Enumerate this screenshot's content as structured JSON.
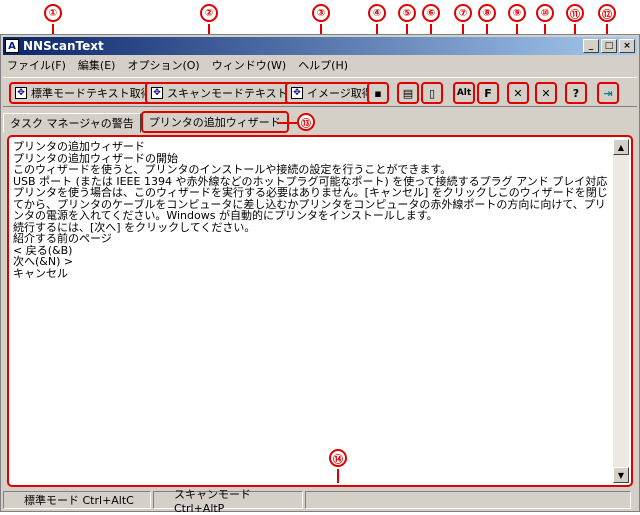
{
  "callouts": [
    "①",
    "②",
    "③",
    "④",
    "⑤",
    "⑥",
    "⑦",
    "⑧",
    "⑨",
    "⑩",
    "⑪",
    "⑫",
    "⑬",
    "⑭"
  ],
  "window": {
    "title": "NNScanText",
    "min_label": "_",
    "max_label": "□",
    "close_label": "×"
  },
  "menu": [
    "ファイル(F)",
    "編集(E)",
    "オプション(O)",
    "ウィンドウ(W)",
    "ヘルプ(H)"
  ],
  "toolbar": {
    "standard_label": "標準モードテキスト取得",
    "scan_label": "スキャンモードテキスト取得",
    "image_label": "イメージ取得",
    "alt_label": "Alt",
    "f_label": "F",
    "help_label": "?"
  },
  "tabs": [
    "タスク マネージャの警告",
    "プリンタの追加ウィザード"
  ],
  "content": {
    "text": "プリンタの追加ウィザード\nプリンタの追加ウィザードの開始\nこのウィザードを使うと、プリンタのインストールや接続の設定を行うことができます。\nUSB ポート (または IEEE 1394 や赤外線などのホットプラグ可能なポート) を使って接続するプラグ アンド プレイ対応プリンタを使う場合は、このウィザードを実行する必要はありません。[キャンセル] をクリックしこのウィザードを閉じてから、プリンタのケーブルをコンピュータに差し込むかプリンタをコンピュータの赤外線ポートの方向に向けて、プリンタの電源を入れてください。Windows が自動的にプリンタをインストールします。\n続行するには、[次へ] をクリックしてください。\n紹介する前のページ\n< 戻る(&B)\n次へ(&N) >\nキャンセル"
  },
  "status": [
    "標準モード Ctrl+AltC",
    "スキャンモード Ctrl+AltP"
  ],
  "colors": {
    "highlight": "#e00000",
    "titlebar": "#0a246a",
    "face": "#d4d0c8"
  }
}
